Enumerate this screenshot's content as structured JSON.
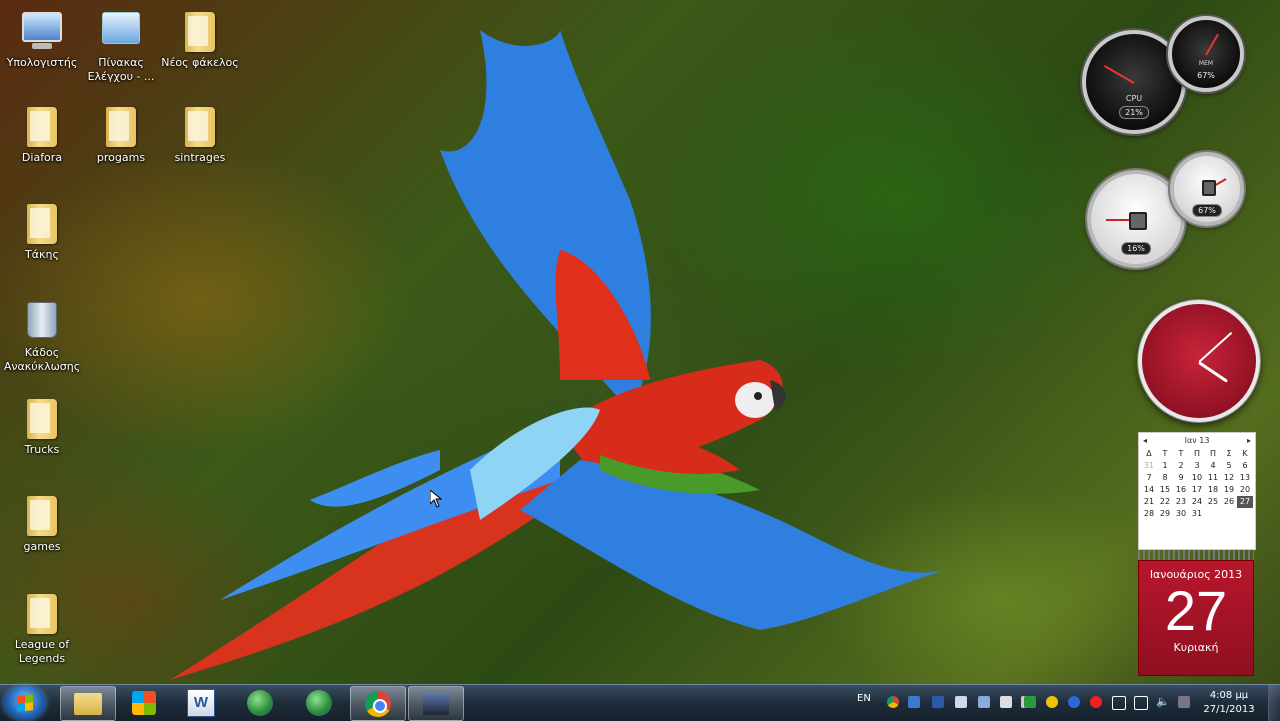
{
  "desktop": {
    "icons": [
      {
        "label": "Υπολογιστής"
      },
      {
        "label": "Πίνακας Ελέγχου - ..."
      },
      {
        "label": "Νέος φάκελος"
      },
      {
        "label": "Diafora"
      },
      {
        "label": "progams"
      },
      {
        "label": "sintrages"
      },
      {
        "label": "Τάκης"
      },
      {
        "label": "Κάδος Ανακύκλωσης"
      },
      {
        "label": "Trucks"
      },
      {
        "label": "games"
      },
      {
        "label": "League of Legends"
      }
    ]
  },
  "gadgets": {
    "cpu_meter": {
      "cpu_label": "CPU",
      "cpu_percent": "21%",
      "mem_label": "MEM",
      "mem_percent": "67%"
    },
    "drive_meter": {
      "primary_percent": "16%",
      "secondary_percent": "67%"
    },
    "clock": {
      "hour": 4,
      "minute": 8
    },
    "calendar": {
      "month_header": "Ιαν 13",
      "weekdays": [
        "Δ",
        "Τ",
        "Τ",
        "Π",
        "Π",
        "Σ",
        "Κ"
      ],
      "days": [
        [
          "31",
          "1",
          "2",
          "3",
          "4",
          "5",
          "6"
        ],
        [
          "7",
          "8",
          "9",
          "10",
          "11",
          "12",
          "13"
        ],
        [
          "14",
          "15",
          "16",
          "17",
          "18",
          "19",
          "20"
        ],
        [
          "21",
          "22",
          "23",
          "24",
          "25",
          "26",
          "27"
        ],
        [
          "28",
          "29",
          "30",
          "31",
          "",
          "",
          ""
        ]
      ],
      "month_year": "Ιανουάριος 2013",
      "day": "27",
      "weekday_name": "Κυριακή"
    }
  },
  "taskbar": {
    "language": "EN",
    "time": "4:08 μμ",
    "date": "27/1/2013",
    "colors": {
      "accent": "#1c5fae",
      "calendar_red": "#b8172c"
    }
  }
}
